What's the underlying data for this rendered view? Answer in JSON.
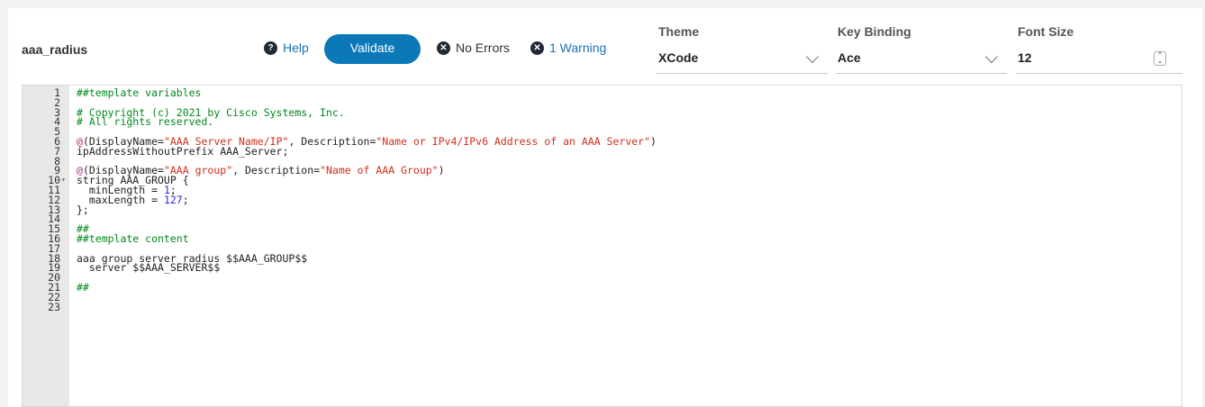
{
  "template_name": "aaa_radius",
  "toolbar": {
    "help_label": "Help",
    "help_icon": "question-circle-icon",
    "validate_label": "Validate",
    "no_errors_label": "No Errors",
    "warning_label": "1 Warning",
    "error_icon": "x-circle-icon"
  },
  "settings": {
    "theme": {
      "label": "Theme",
      "value": "XCode"
    },
    "key_binding": {
      "label": "Key Binding",
      "value": "Ace"
    },
    "font_size": {
      "label": "Font Size",
      "value": "12"
    }
  },
  "colors": {
    "accent": "#0b79b8",
    "link": "#1b72b8",
    "comment": "#008a1b",
    "string": "#d12f1b",
    "number": "#272ad8"
  },
  "editor": {
    "lines": [
      {
        "n": "1",
        "text": "##template variables"
      },
      {
        "n": "2",
        "text": ""
      },
      {
        "n": "3",
        "text": "# Copyright (c) 2021 by Cisco Systems, Inc."
      },
      {
        "n": "4",
        "text": "# All rights reserved."
      },
      {
        "n": "5",
        "text": ""
      },
      {
        "n": "6",
        "text": "@(DisplayName=\"AAA Server Name/IP\", Description=\"Name or IPv4/IPv6 Address of an AAA Server\")"
      },
      {
        "n": "7",
        "text": "ipAddressWithoutPrefix AAA_Server;"
      },
      {
        "n": "8",
        "text": ""
      },
      {
        "n": "9",
        "text": "@(DisplayName=\"AAA group\", Description=\"Name of AAA Group\")"
      },
      {
        "n": "10",
        "text": "string AAA_GROUP {",
        "fold": "▾"
      },
      {
        "n": "11",
        "text": "  minLength = 1;"
      },
      {
        "n": "12",
        "text": "  maxLength = 127;"
      },
      {
        "n": "13",
        "text": "};"
      },
      {
        "n": "14",
        "text": ""
      },
      {
        "n": "15",
        "text": "##"
      },
      {
        "n": "16",
        "text": "##template content"
      },
      {
        "n": "17",
        "text": ""
      },
      {
        "n": "18",
        "text": "aaa group server radius $$AAA_GROUP$$"
      },
      {
        "n": "19",
        "text": "  server $$AAA_SERVER$$"
      },
      {
        "n": "20",
        "text": ""
      },
      {
        "n": "21",
        "text": "##"
      },
      {
        "n": "22",
        "text": ""
      },
      {
        "n": "23",
        "text": ""
      }
    ]
  }
}
